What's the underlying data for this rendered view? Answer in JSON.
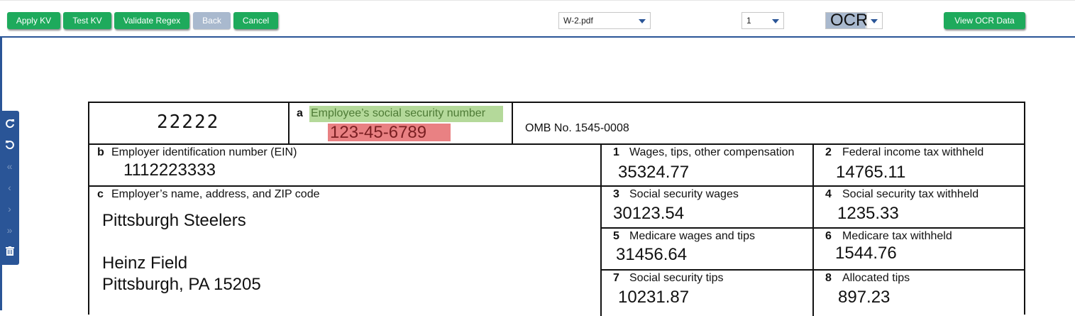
{
  "toolbar": {
    "buttons": [
      {
        "label": "Apply KV"
      },
      {
        "label": "Test KV"
      },
      {
        "label": "Validate Regex"
      },
      {
        "label": "Back"
      },
      {
        "label": "Cancel"
      }
    ],
    "file_select": "W-2.pdf",
    "page_select": "1",
    "mode_select": "OCR",
    "view_ocr_label": "View OCR Data"
  },
  "side_tools": [
    "rotate-clockwise-icon",
    "rotate-counterclockwise-icon",
    "first-page-icon",
    "prev-page-icon",
    "next-page-icon",
    "last-page-icon",
    "trash-icon"
  ],
  "form": {
    "control_number": "22222",
    "ssn": {
      "letter": "a",
      "label": "Employee’s social security number",
      "value": "123-45-6789"
    },
    "omb": "OMB No. 1545-0008",
    "ein": {
      "letter": "b",
      "label": "Employer identification number (EIN)",
      "value": "1112223333"
    },
    "employer": {
      "letter": "c",
      "label": "Employer’s name, address, and ZIP code",
      "name": "Pittsburgh Steelers",
      "address1": "Heinz Field",
      "address2": "Pittsburgh, PA 15205"
    },
    "boxes": [
      {
        "num": "1",
        "label": "Wages, tips, other compensation",
        "value": "35324.77"
      },
      {
        "num": "2",
        "label": "Federal income tax withheld",
        "value": "14765.11"
      },
      {
        "num": "3",
        "label": "Social security wages",
        "value": "30123.54"
      },
      {
        "num": "4",
        "label": "Social security tax withheld",
        "value": "1235.33"
      },
      {
        "num": "5",
        "label": "Medicare wages and tips",
        "value": "31456.64"
      },
      {
        "num": "6",
        "label": "Medicare tax withheld",
        "value": "1544.76"
      },
      {
        "num": "7",
        "label": "Social security tips",
        "value": "10231.87"
      },
      {
        "num": "8",
        "label": "Allocated tips",
        "value": "897.23"
      }
    ]
  },
  "colors": {
    "button_green": "#1eaa5c",
    "accent_blue": "#2a5597",
    "disabled": "#a9b9ce",
    "highlight_key": "#b4d99a",
    "highlight_value": "#e98183"
  }
}
